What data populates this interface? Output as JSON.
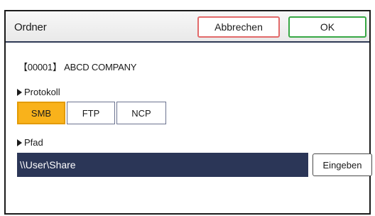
{
  "header": {
    "title": "Ordner",
    "cancel_label": "Abbrechen",
    "ok_label": "OK"
  },
  "destination": {
    "label": "【00001】 ABCD COMPANY"
  },
  "protocol": {
    "label": "Protokoll",
    "options": [
      "SMB",
      "FTP",
      "NCP"
    ],
    "selected": "SMB"
  },
  "path": {
    "label": "Pfad",
    "value": "\\\\User\\Share",
    "enter_label": "Eingeben"
  },
  "colors": {
    "selected_accent": "#f9b21b",
    "path_field_bg": "#2b3657",
    "cancel_border": "#e26a6a",
    "ok_border": "#38a845"
  }
}
